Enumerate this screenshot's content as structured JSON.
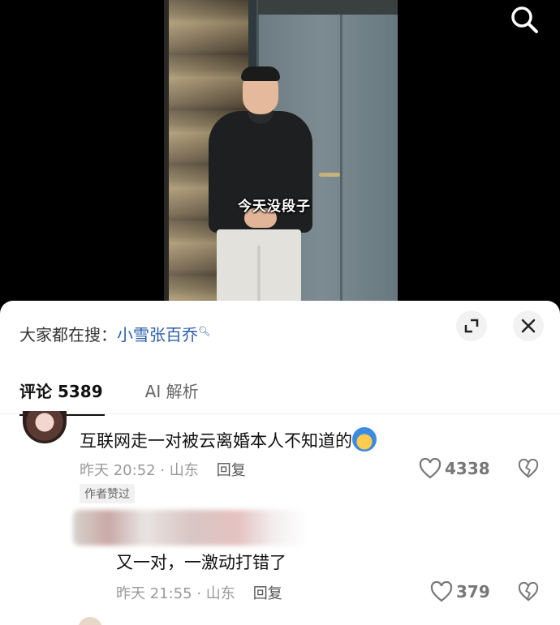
{
  "video": {
    "caption": "今天没段子"
  },
  "icons": {
    "search": "search-icon",
    "expand": "expand-icon",
    "close": "close-icon",
    "like": "heart-icon",
    "dislike": "broken-heart-icon"
  },
  "sheet": {
    "hot_search_prefix": "大家都在搜：",
    "hot_search_keyword": "小雪张百乔",
    "tabs": [
      {
        "label": "评论 5389",
        "active": true
      },
      {
        "label": "AI 解析",
        "active": false
      }
    ]
  },
  "comments": [
    {
      "text": "互联网走一对被云离婚本人不知道的",
      "time_location": "昨天 20:52 · 山东",
      "reply_label": "回复",
      "likes": "4338",
      "badge": "作者赞过"
    },
    {
      "text": "又一对，一激动打错了",
      "time_location": "昨天 21:55 · 山东",
      "reply_label": "回复",
      "likes": "379"
    }
  ],
  "colors": {
    "keyword": "#2b5ea8",
    "sheet_bg": "#ffffff"
  }
}
